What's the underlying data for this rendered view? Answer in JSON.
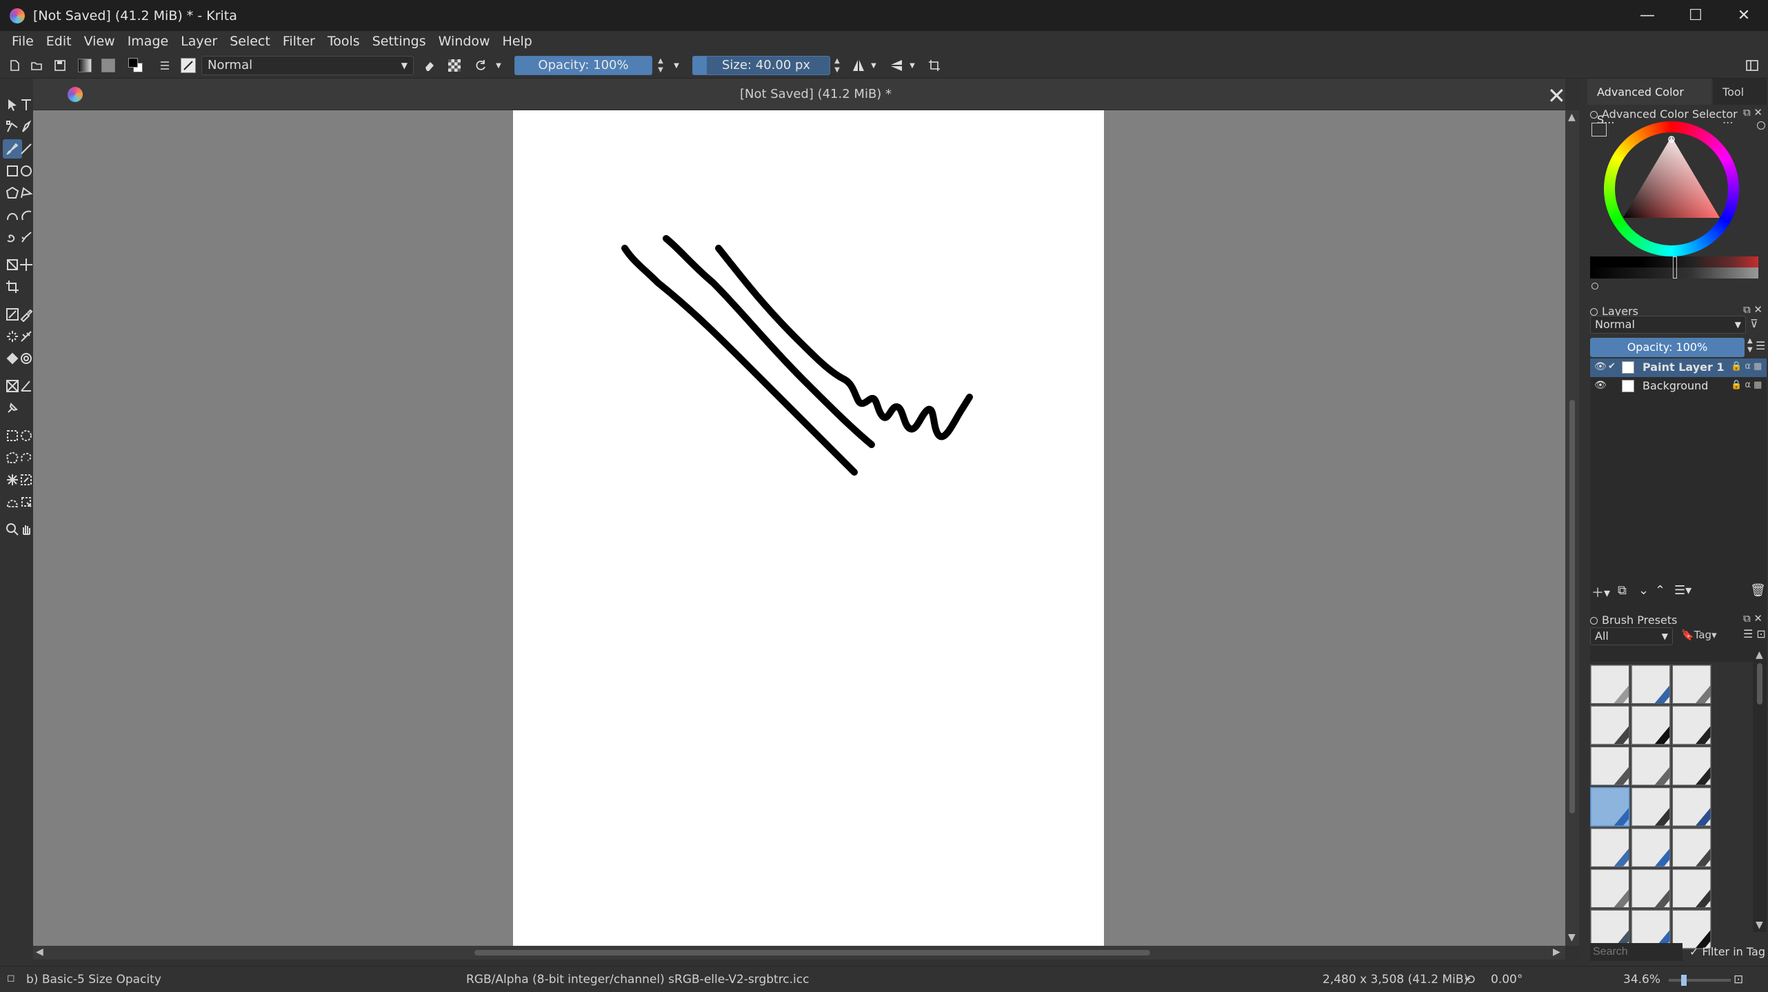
{
  "window": {
    "title": "[Not Saved]  (41.2 MiB) * - Krita",
    "minimize": "—",
    "maximize": "☐",
    "close": "✕"
  },
  "menu": [
    "File",
    "Edit",
    "View",
    "Image",
    "Layer",
    "Select",
    "Filter",
    "Tools",
    "Settings",
    "Window",
    "Help"
  ],
  "toolbar": {
    "blend_mode": "Normal",
    "opacity_label": "Opacity: 100%",
    "opacity_fraction": 1.0,
    "size_label": "Size: 40.00 px",
    "size_fraction": 0.1
  },
  "document": {
    "tab_title": "[Not Saved]  (41.2 MiB) *",
    "close": "✕"
  },
  "dock": {
    "tabs": [
      "Advanced Color S...",
      "Tool ..."
    ],
    "color_selector_title": "Advanced Color Selector",
    "layers_title": "Layers",
    "layers_blend": "Normal",
    "layers_opacity": "Opacity:  100%",
    "layers": [
      {
        "name": "Paint Layer 1",
        "active": true
      },
      {
        "name": "Background",
        "active": false
      }
    ],
    "brush_presets_title": "Brush Presets",
    "preset_filter": "All",
    "tag_label": "Tag",
    "search_placeholder": "Search",
    "filter_in_tag": "Filter in Tag"
  },
  "status": {
    "brush": "b) Basic-5 Size Opacity",
    "color_profile": "RGB/Alpha (8-bit integer/channel)  sRGB-elle-V2-srgbtrc.icc",
    "dimensions": "2,480 x 3,508 (41.2 MiB)",
    "rotation": "0.00°",
    "zoom": "34.6%"
  }
}
